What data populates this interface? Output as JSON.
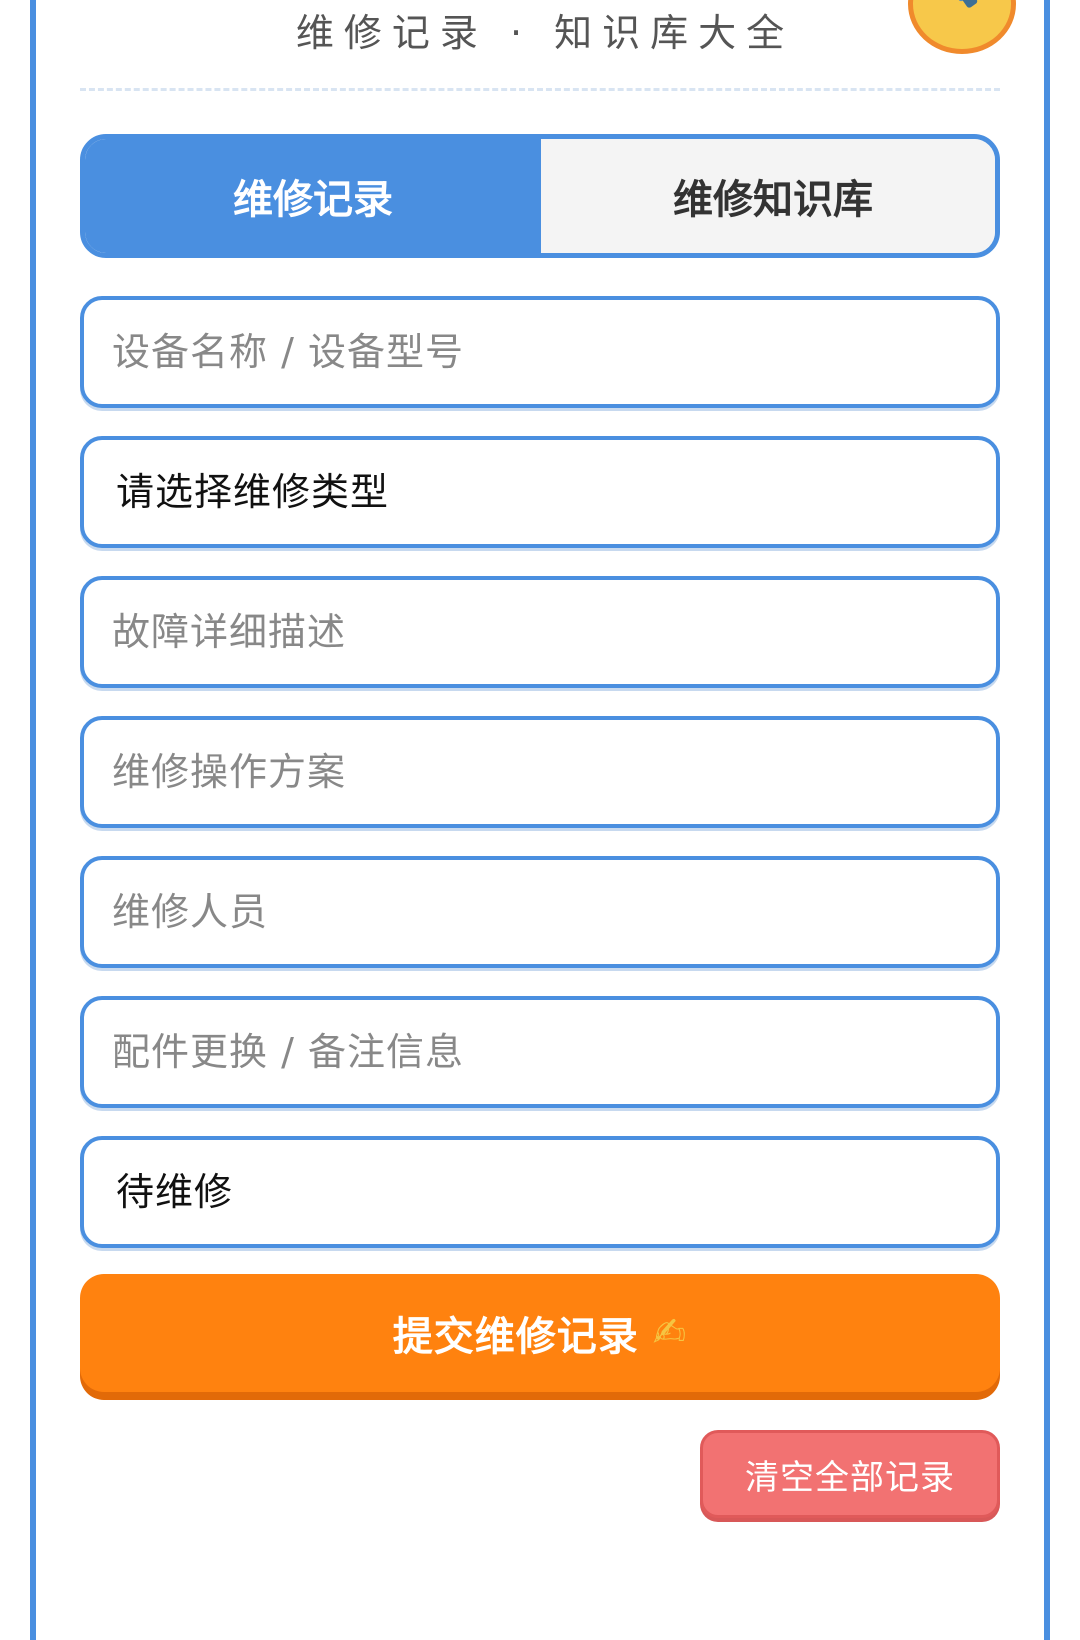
{
  "header": {
    "subtitle": "维修记录 · 知识库大全",
    "badge_icon": "wrench-icon"
  },
  "tabs": [
    {
      "label": "维修记录",
      "active": true
    },
    {
      "label": "维修知识库",
      "active": false
    }
  ],
  "form": {
    "device_placeholder": "设备名称 / 设备型号",
    "repair_type_selected": "请选择维修类型",
    "fault_placeholder": "故障详细描述",
    "plan_placeholder": "维修操作方案",
    "staff_placeholder": "维修人员",
    "parts_placeholder": "配件更换 / 备注信息",
    "status_selected": "待维修"
  },
  "actions": {
    "submit_label": "提交维修记录",
    "submit_icon": "writing-hand-icon",
    "clear_label": "清空全部记录"
  },
  "colors": {
    "primary": "#4a8fe0",
    "submit": "#ff820f",
    "danger": "#f27272"
  }
}
